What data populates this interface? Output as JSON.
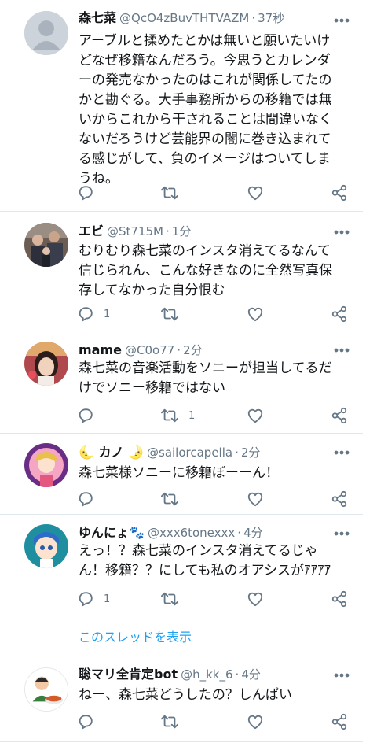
{
  "tweets": [
    {
      "name": "森七菜",
      "handle": "@QcO4zBuvTHTVAZM",
      "time": "37秒",
      "lines": [
        "アーブルと揉めたとかは無いと願いたいけ",
        "どなぜ移籍なんだろう。今思うとカレンダ",
        "ーの発売なかったのはこれが関係してたの",
        "かと勘ぐる。大手事務所からの移籍では無",
        "いからこれから干されることは間違いなく",
        "ないだろうけど芸能界の闇に巻き込まれて",
        "る感じがして、負のイメージはついてしま",
        "うね。"
      ],
      "reply_count": "",
      "retweet_count": "",
      "avatar": "default-avatar"
    },
    {
      "name": "エビ",
      "handle": "@St715M",
      "time": "1分",
      "lines": [
        "むりむり森七菜のインスタ消えてるなんて",
        "信じられん、こんな好きなのに全然写真保",
        "存してなかった自分恨む"
      ],
      "reply_count": "1",
      "retweet_count": "",
      "avatar": "people-photo"
    },
    {
      "name": "mame",
      "handle": "@C0o77",
      "time": "2分",
      "lines": [
        "森七菜の音楽活動をソニーが担当してるだ",
        "けでソニー移籍ではない"
      ],
      "reply_count": "",
      "retweet_count": "1",
      "avatar": "girl-photo"
    },
    {
      "name": "🌜 カノ 🌛",
      "handle": "@sailorcapella",
      "time": "2分",
      "lines": [
        "森七菜様ソニーに移籍ぼーーん！"
      ],
      "reply_count": "",
      "retweet_count": "",
      "avatar": "anime-pink"
    },
    {
      "name": "ゆんにょ🐾",
      "handle": "@xxx6tonexxx",
      "time": "4分",
      "lines": [
        "えっ！？森七菜のインスタ消えてるじゃ",
        "ん！移籍？？にしても私のオアシスがｱｱｱｱ"
      ],
      "reply_count": "1",
      "retweet_count": "",
      "avatar": "anime-teal"
    },
    {
      "name": "聡マリ全肯定bot",
      "handle": "@h_kk_6",
      "time": "4分",
      "lines": [
        "ねー、森七菜どうしたの？しんぱい"
      ],
      "reply_count": "",
      "retweet_count": "",
      "avatar": "illustration-man"
    }
  ],
  "show_thread_label": "このスレッドを表示",
  "colors": {
    "text": "#14171a",
    "secondary": "#657786",
    "link": "#1da1f2",
    "divider": "#e1e8ed"
  }
}
